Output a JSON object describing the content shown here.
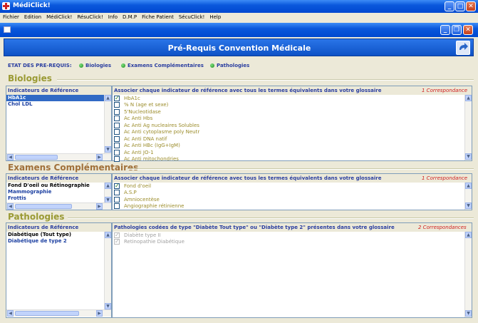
{
  "window": {
    "title": "MédiClick!"
  },
  "menu": [
    "Fichier",
    "Edition",
    "MédiClick!",
    "RésuClick!",
    "Info",
    "D.M.P",
    "Fiche Patient",
    "SécuClick!",
    "Help"
  ],
  "header": {
    "title": "Pré-Requis Convention Médicale"
  },
  "status": {
    "label": "ETAT DES PRE-REQUIS:",
    "items": [
      "Biologies",
      "Examens Complémentaires",
      "Pathologies"
    ],
    "dot_color": "#1a8a1a"
  },
  "biologies": {
    "title": "Biologies",
    "left_header": "Indicateurs de Référence",
    "right_header": "Associer chaque indicateur de référence avec tous les termes équivalents dans votre glossaire",
    "correspondance": "1 Correspondance",
    "indicators": [
      "HbA1c",
      "Chol LDL"
    ],
    "terms": [
      {
        "label": "HbA1c",
        "checked": true
      },
      {
        "label": "% N (age et sexe)",
        "checked": false
      },
      {
        "label": "5'Nucleotidase",
        "checked": false
      },
      {
        "label": "Ac Anti  Hbs",
        "checked": false
      },
      {
        "label": "Ac Anti Ag nucleaires Solubles",
        "checked": false
      },
      {
        "label": "Ac Anti cytoplasme poly Neutr",
        "checked": false
      },
      {
        "label": "Ac Anti DNA natif",
        "checked": false
      },
      {
        "label": "Ac Anti HBc (IgG+IgM)",
        "checked": false
      },
      {
        "label": "Ac Anti JO-1",
        "checked": false
      },
      {
        "label": "Ac Anti mitochondries",
        "checked": false
      }
    ]
  },
  "examens": {
    "title": "Examens Complémentaires",
    "left_header": "Indicateurs de Référence",
    "right_header": "Associer chaque indicateur de référence avec tous les termes équivalents dans votre glossaire",
    "correspondance": "1 Correspondance",
    "indicators": [
      "Fond D'oeil ou Rétinographie",
      "Mammographie",
      "Frottis"
    ],
    "terms": [
      {
        "label": "Fond d'oeil",
        "checked": true
      },
      {
        "label": "A.S.P",
        "checked": false
      },
      {
        "label": "Amniocentèse",
        "checked": false
      },
      {
        "label": "Angiographie rétinienne",
        "checked": false
      }
    ]
  },
  "pathologies": {
    "title": "Pathologies",
    "left_header": "Indicateurs de Référence",
    "right_header": "Pathologies codées de type \"Diabète Tout type\" ou \"Diabète type 2\" présentes dans votre glossaire",
    "correspondance": "2 Correspondances",
    "indicators": [
      "Diabétique (Tout type)",
      "Diabétique de type 2"
    ],
    "terms": [
      {
        "label": "Diabète type II",
        "checked": true
      },
      {
        "label": "Retinopathie Diabétique",
        "checked": true
      }
    ]
  }
}
